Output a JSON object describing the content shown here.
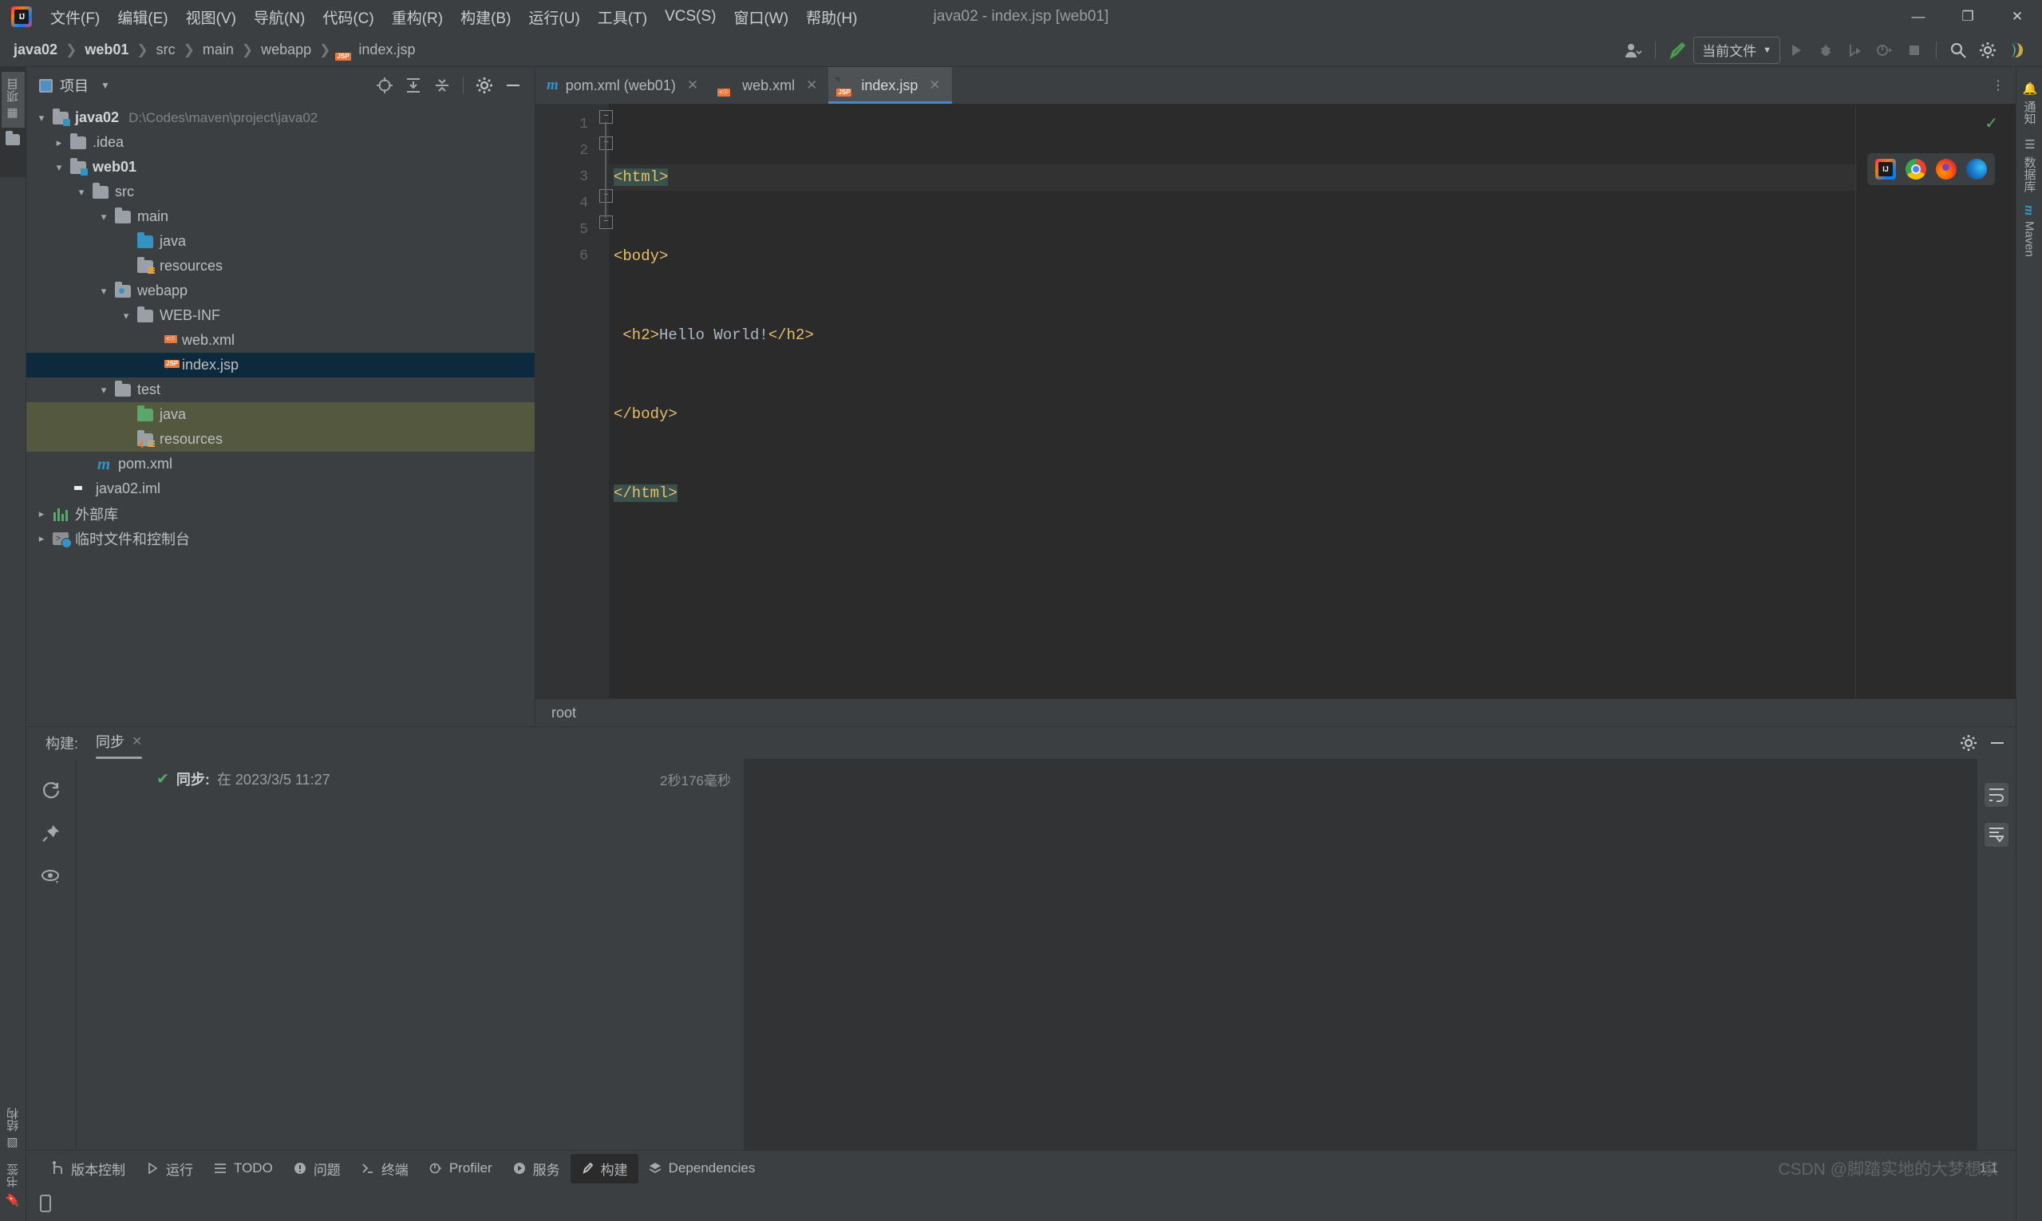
{
  "window": {
    "title": "java02 - index.jsp [web01]",
    "logo_text": "IJ",
    "minimize": "—",
    "maximize": "❐",
    "close": "✕"
  },
  "menu": [
    {
      "label": "文件(F)",
      "name": "menu-file"
    },
    {
      "label": "编辑(E)",
      "name": "menu-edit"
    },
    {
      "label": "视图(V)",
      "name": "menu-view"
    },
    {
      "label": "导航(N)",
      "name": "menu-navigate"
    },
    {
      "label": "代码(C)",
      "name": "menu-code"
    },
    {
      "label": "重构(R)",
      "name": "menu-refactor"
    },
    {
      "label": "构建(B)",
      "name": "menu-build"
    },
    {
      "label": "运行(U)",
      "name": "menu-run"
    },
    {
      "label": "工具(T)",
      "name": "menu-tools"
    },
    {
      "label": "VCS(S)",
      "name": "menu-vcs"
    },
    {
      "label": "窗口(W)",
      "name": "menu-window"
    },
    {
      "label": "帮助(H)",
      "name": "menu-help"
    }
  ],
  "breadcrumb": [
    {
      "label": "java02",
      "bold": true
    },
    {
      "label": "web01",
      "bold": true
    },
    {
      "label": "src",
      "bold": false
    },
    {
      "label": "main",
      "bold": false
    },
    {
      "label": "webapp",
      "bold": false
    },
    {
      "label": "index.jsp",
      "bold": false
    }
  ],
  "navbar_right": {
    "run_config": "当前文件",
    "icons": [
      "user-avatar-icon",
      "build-hammer-icon",
      "run-icon",
      "debug-icon",
      "run-coverage-icon",
      "profiler-icon",
      "stop-icon",
      "search-icon",
      "settings-icon",
      "ide-assistant-icon"
    ]
  },
  "project_panel": {
    "title": "项目",
    "toolbar_icons": [
      "locate-icon",
      "expand-all-icon",
      "collapse-all-icon",
      "settings-icon",
      "hide-icon"
    ],
    "tree": [
      {
        "indent": 0,
        "arrow": "down",
        "icon": "folder-module",
        "label": "java02",
        "bold": true,
        "path": "D:\\Codes\\maven\\project\\java02",
        "state": "normal"
      },
      {
        "indent": 1,
        "arrow": "right",
        "icon": "folder",
        "label": ".idea",
        "bold": false,
        "path": "",
        "state": "normal"
      },
      {
        "indent": 1,
        "arrow": "down",
        "icon": "folder-module",
        "label": "web01",
        "bold": true,
        "path": "",
        "state": "normal"
      },
      {
        "indent": 2,
        "arrow": "down",
        "icon": "folder",
        "label": "src",
        "bold": false,
        "path": "",
        "state": "normal"
      },
      {
        "indent": 3,
        "arrow": "down",
        "icon": "folder",
        "label": "main",
        "bold": false,
        "path": "",
        "state": "normal"
      },
      {
        "indent": 4,
        "arrow": "none",
        "icon": "folder-sources",
        "label": "java",
        "bold": false,
        "path": "",
        "state": "normal"
      },
      {
        "indent": 4,
        "arrow": "none",
        "icon": "folder-resources",
        "label": "resources",
        "bold": false,
        "path": "",
        "state": "normal"
      },
      {
        "indent": 3,
        "arrow": "down",
        "icon": "folder-webapp",
        "label": "webapp",
        "bold": false,
        "path": "",
        "state": "normal"
      },
      {
        "indent": 4,
        "arrow": "down",
        "icon": "folder",
        "label": "WEB-INF",
        "bold": false,
        "path": "",
        "state": "normal"
      },
      {
        "indent": 5,
        "arrow": "none",
        "icon": "file-xml",
        "label": "web.xml",
        "bold": false,
        "path": "",
        "state": "normal"
      },
      {
        "indent": 5,
        "arrow": "none",
        "icon": "file-jsp",
        "label": "index.jsp",
        "bold": false,
        "path": "",
        "state": "selected"
      },
      {
        "indent": 3,
        "arrow": "down",
        "icon": "folder",
        "label": "test",
        "bold": false,
        "path": "",
        "state": "normal"
      },
      {
        "indent": 4,
        "arrow": "none",
        "icon": "folder-test-sources",
        "label": "java",
        "bold": false,
        "path": "",
        "state": "green"
      },
      {
        "indent": 4,
        "arrow": "none",
        "icon": "folder-test-resources",
        "label": "resources",
        "bold": false,
        "path": "",
        "state": "green"
      },
      {
        "indent": 2,
        "arrow": "none",
        "icon": "file-maven",
        "label": "pom.xml",
        "bold": false,
        "path": "",
        "state": "normal"
      },
      {
        "indent": 1,
        "arrow": "none",
        "icon": "file-iml",
        "label": "java02.iml",
        "bold": false,
        "path": "",
        "state": "normal"
      },
      {
        "indent": 0,
        "arrow": "right",
        "icon": "external-libraries",
        "label": "外部库",
        "bold": false,
        "path": "",
        "state": "normal"
      },
      {
        "indent": 0,
        "arrow": "right",
        "icon": "scratches-console",
        "label": "临时文件和控制台",
        "bold": false,
        "path": "",
        "state": "normal"
      }
    ]
  },
  "editor": {
    "tabs": [
      {
        "label": "pom.xml (web01)",
        "icon": "maven-icon",
        "active": false,
        "close": "✕"
      },
      {
        "label": "web.xml",
        "icon": "xml-icon",
        "active": false,
        "close": "✕"
      },
      {
        "label": "index.jsp",
        "icon": "jsp-icon",
        "active": true,
        "close": "✕"
      }
    ],
    "line_numbers": [
      "1",
      "2",
      "3",
      "4",
      "5",
      "6"
    ],
    "lines": [
      {
        "n": 1,
        "segments": [
          {
            "t": "<html>",
            "c": "tag",
            "match": true
          }
        ],
        "highlight": true,
        "fold": "minus"
      },
      {
        "n": 2,
        "segments": [
          {
            "t": "<body>",
            "c": "tag",
            "match": false
          }
        ],
        "highlight": false,
        "fold": "minus"
      },
      {
        "n": 3,
        "segments": [
          {
            "t": " <h2>",
            "c": "tag",
            "match": false
          },
          {
            "t": "Hello World!",
            "c": "text",
            "match": false
          },
          {
            "t": "</h2>",
            "c": "tag",
            "match": false
          }
        ],
        "highlight": false,
        "fold": "none"
      },
      {
        "n": 4,
        "segments": [
          {
            "t": "</body>",
            "c": "tag",
            "match": false
          }
        ],
        "highlight": false,
        "fold": "plus"
      },
      {
        "n": 5,
        "segments": [
          {
            "t": "</html>",
            "c": "tag",
            "match": true
          }
        ],
        "highlight": false,
        "fold": "plus"
      },
      {
        "n": 6,
        "segments": [],
        "highlight": false,
        "fold": "none"
      }
    ],
    "browsers": [
      "intellij-browser-icon",
      "chrome-icon",
      "firefox-icon",
      "edge-icon"
    ],
    "inspection_status": "✓",
    "breadcrumb_status": "root"
  },
  "build_panel": {
    "label": "构建:",
    "tab": "同步",
    "tab_close": "✕",
    "header_icons": [
      "settings-icon",
      "hide-icon"
    ],
    "tool_icons": [
      "rerun-icon",
      "pin-icon",
      "eye-filter-icon"
    ],
    "rows": [
      {
        "status": "✔",
        "title": "同步:",
        "detail": "在 2023/3/5 11:27",
        "duration": "2秒176毫秒"
      }
    ],
    "right_icons": [
      "soft-wrap-icon",
      "scroll-to-end-icon"
    ]
  },
  "left_stripe": [
    {
      "label": "项目",
      "icon": "project-icon",
      "active": true
    },
    {
      "label": "",
      "icon": "commit-folder-icon",
      "active": false
    }
  ],
  "left_stripe_bottom": [
    {
      "label": "结构",
      "icon": "structure-icon",
      "active": false
    },
    {
      "label": "书签",
      "icon": "bookmark-icon",
      "active": false
    }
  ],
  "right_stripe": [
    {
      "label": "通知",
      "icon": "bell-icon",
      "active": false
    },
    {
      "label": "数据库",
      "icon": "database-icon",
      "active": false
    },
    {
      "label": "Maven",
      "icon": "maven-icon",
      "active": false
    }
  ],
  "status_bar": {
    "buttons": [
      {
        "label": "版本控制",
        "icon": "vcs-icon",
        "active": false
      },
      {
        "label": "运行",
        "icon": "run-icon",
        "active": false
      },
      {
        "label": "TODO",
        "icon": "todo-icon",
        "active": false
      },
      {
        "label": "问题",
        "icon": "problems-icon",
        "active": false
      },
      {
        "label": "终端",
        "icon": "terminal-icon",
        "active": false
      },
      {
        "label": "Profiler",
        "icon": "profiler-icon",
        "active": false
      },
      {
        "label": "服务",
        "icon": "services-icon",
        "active": false
      },
      {
        "label": "构建",
        "icon": "build-icon",
        "active": true
      },
      {
        "label": "Dependencies",
        "icon": "dependencies-icon",
        "active": false
      }
    ],
    "caret_position": "1:1",
    "watermark": "CSDN @脚踏实地的大梦想家"
  },
  "colors": {
    "accent": "#4a88c7",
    "selection": "#0d293e",
    "test_source": "#53583f",
    "tag": "#e8bf6a",
    "text": "#a9b7c6",
    "ok_green": "#59a869",
    "background": "#3c3f41",
    "editor_background": "#2b2b2b"
  }
}
